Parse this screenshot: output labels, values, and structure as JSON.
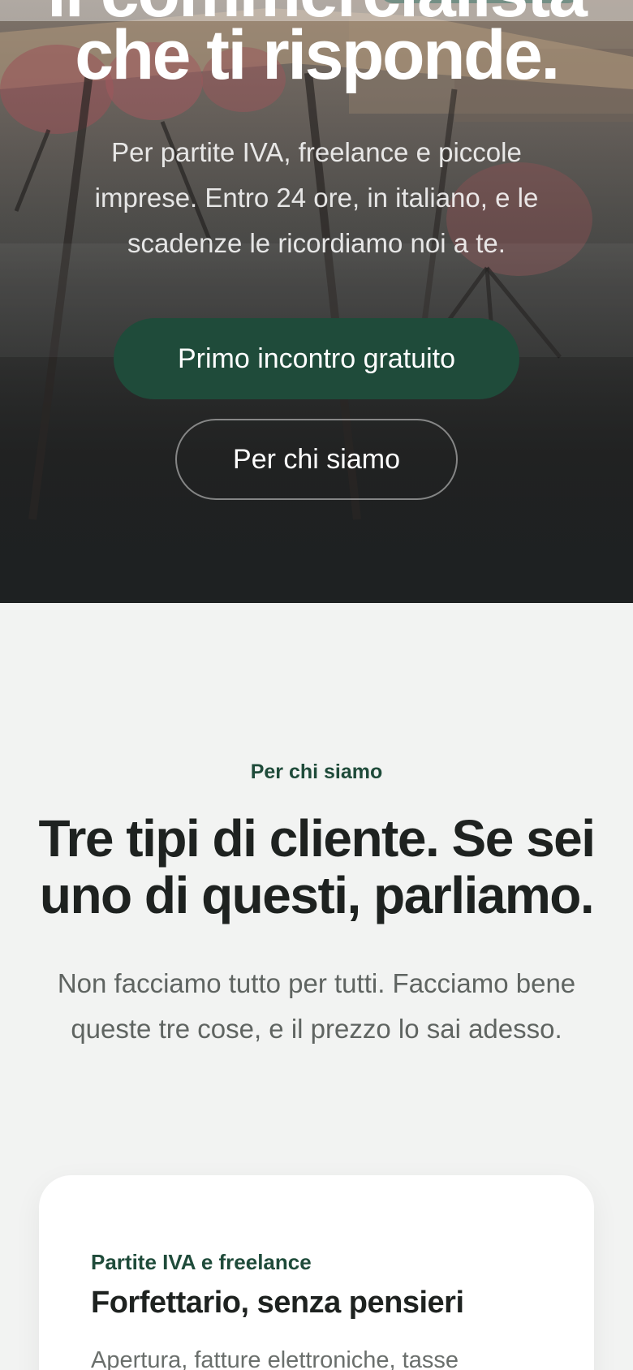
{
  "hero": {
    "title_cut": "il commercialista",
    "title": "che ti risponde.",
    "subtitle": "Per partite IVA, freelance e piccole imprese. Entro 24 ore, in italiano, e le scadenze le ricordiamo noi a te.",
    "cta_primary": "Primo incontro gratuito",
    "cta_secondary": "Per chi siamo"
  },
  "section": {
    "eyebrow": "Per chi siamo",
    "title": "Tre tipi di cliente. Se sei uno di questi, parliamo.",
    "lead": "Non facciamo tutto per tutti. Facciamo bene queste tre cose, e il prezzo lo sai adesso."
  },
  "card": {
    "eyebrow": "Partite IVA e freelance",
    "title": "Forfettario, senza pensieri",
    "text": "Apertura, fatture elettroniche, tasse"
  },
  "colors": {
    "brand_green": "#1f4b3a",
    "page_bg": "#f2f3f2",
    "heading": "#1e2220"
  }
}
